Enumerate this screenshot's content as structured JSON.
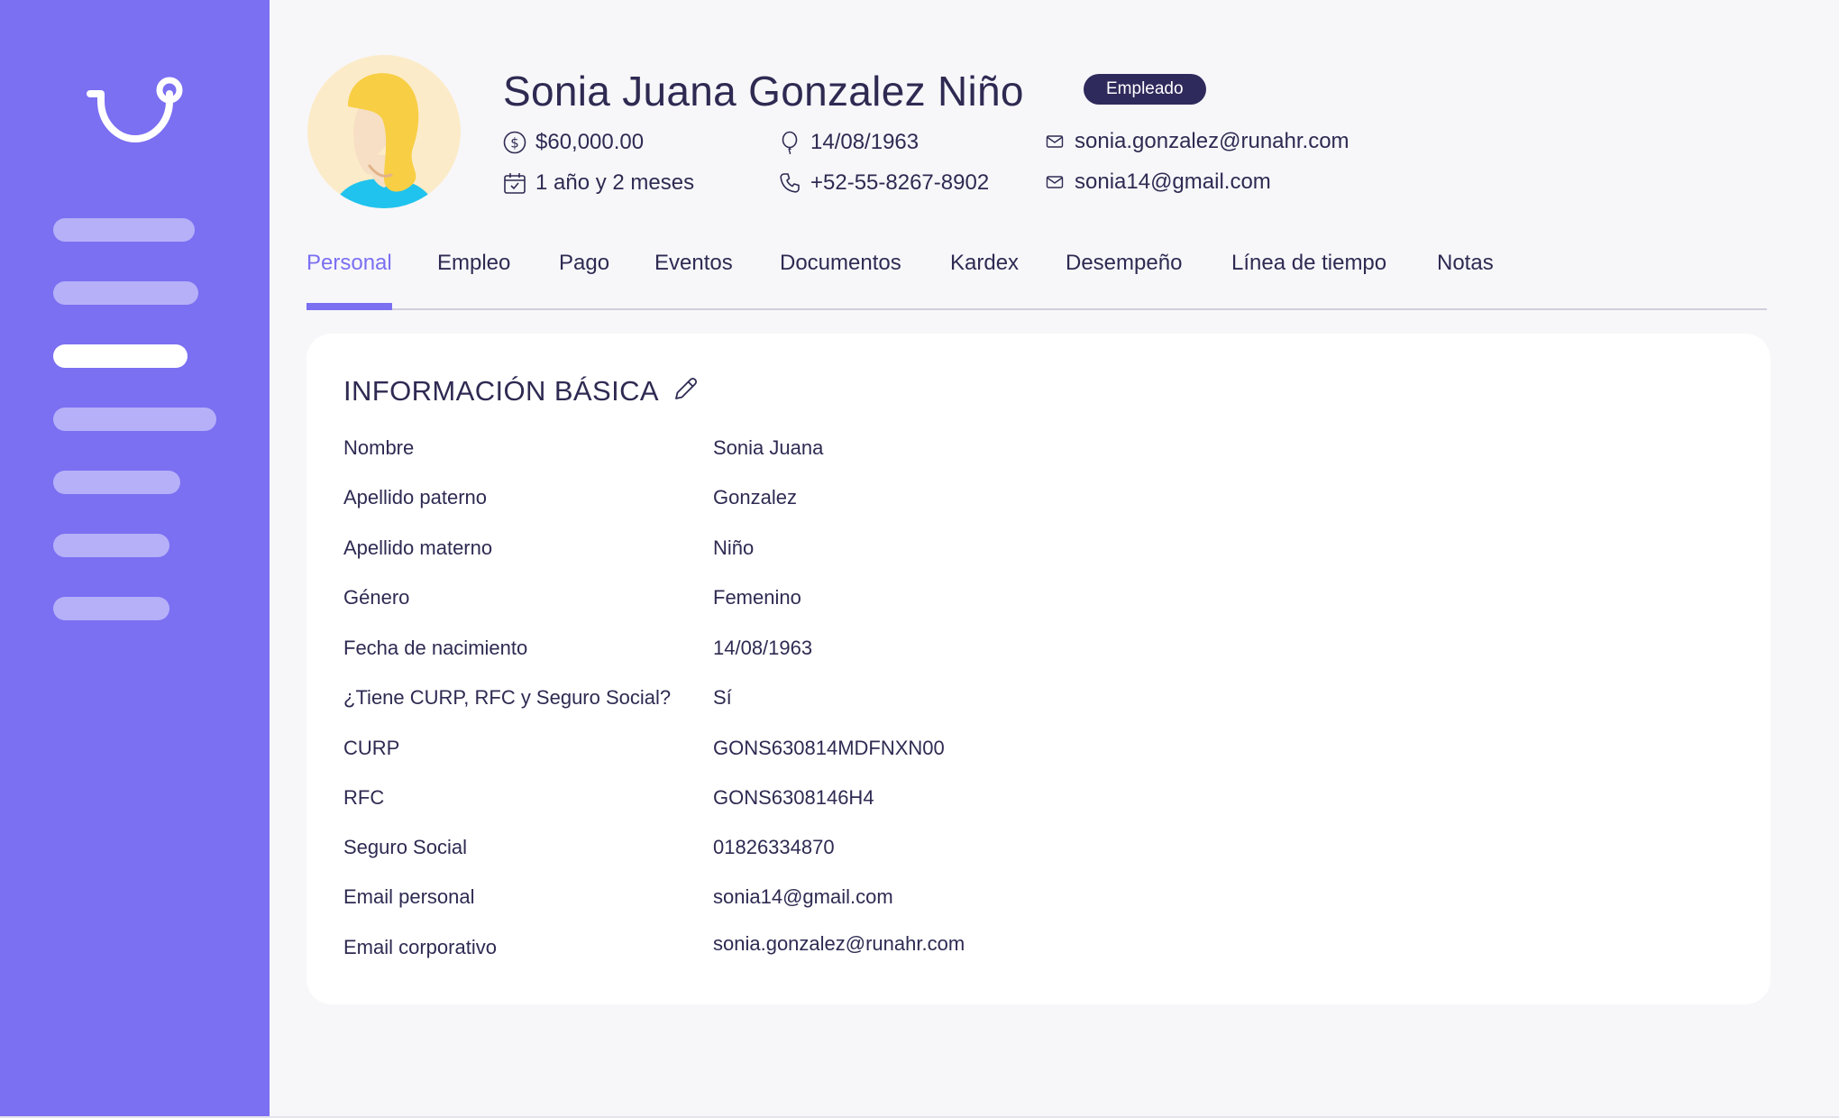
{
  "profile": {
    "name": "Sonia Juana Gonzalez Niño",
    "status_badge": "Empleado",
    "salary": "$60,000.00",
    "tenure": "1 año y 2 meses",
    "birth_date": "14/08/1963",
    "phone": "+52-55-8267-8902",
    "email_corporate": "sonia.gonzalez@runahr.com",
    "email_personal": "sonia14@gmail.com"
  },
  "tabs": [
    {
      "label": "Personal",
      "active": true
    },
    {
      "label": "Empleo"
    },
    {
      "label": "Pago"
    },
    {
      "label": "Eventos"
    },
    {
      "label": "Documentos"
    },
    {
      "label": "Kardex"
    },
    {
      "label": "Desempeño"
    },
    {
      "label": "Línea de tiempo"
    },
    {
      "label": "Notas"
    }
  ],
  "basic_info": {
    "title": "INFORMACIÓN BÁSICA",
    "fields": [
      {
        "label": "Nombre",
        "value": "Sonia Juana"
      },
      {
        "label": "Apellido paterno",
        "value": "Gonzalez"
      },
      {
        "label": "Apellido materno",
        "value": "Niño"
      },
      {
        "label": "Género",
        "value": "Femenino"
      },
      {
        "label": "Fecha de nacimiento",
        "value": "14/08/1963"
      },
      {
        "label": "¿Tiene CURP, RFC y Seguro Social?",
        "value": "Sí"
      },
      {
        "label": "CURP",
        "value": "GONS630814MDFNXN00"
      },
      {
        "label": "RFC",
        "value": "GONS6308146H4"
      },
      {
        "label": "Seguro Social",
        "value": "01826334870"
      },
      {
        "label": "Email personal",
        "value": "sonia14@gmail.com"
      },
      {
        "label": "Email corporativo",
        "value": "sonia.gonzalez@runahr.com"
      }
    ]
  },
  "icons": {
    "logo": "runa-logo",
    "salary": "dollar-circle-icon",
    "tenure": "calendar-icon",
    "birth_date": "balloon-icon",
    "phone": "phone-icon",
    "email": "envelope-icon",
    "edit": "pencil-icon"
  },
  "colors": {
    "sidebar": "#7b6ff2",
    "accent": "#7b6ff2",
    "badge_bg": "#2f2a5c",
    "text": "#2e2a52",
    "background": "#f7f7fa",
    "card": "#ffffff"
  }
}
